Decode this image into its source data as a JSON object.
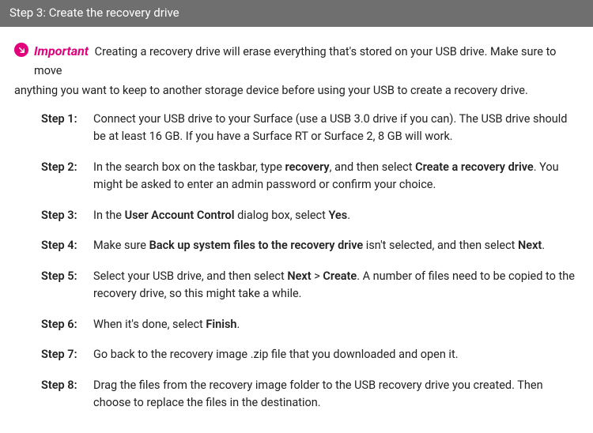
{
  "header": {
    "title": "Step 3: Create the recovery drive"
  },
  "important": {
    "label": "Important",
    "text_a": "Creating a recovery drive will erase everything that's stored on your USB drive. Make sure to move",
    "text_b": "anything you want to keep to another storage device before using your USB to create a recovery drive."
  },
  "steps": [
    {
      "label": "Step 1:",
      "parts": [
        {
          "t": "Connect your USB drive to your Surface (use a USB 3.0 drive if you can). The USB drive should be at least 16 GB. If you have a Surface RT or Surface 2, 8 GB will work."
        }
      ]
    },
    {
      "label": "Step 2:",
      "parts": [
        {
          "t": "In the search box on the taskbar, type "
        },
        {
          "t": "recovery",
          "b": true
        },
        {
          "t": ", and then select "
        },
        {
          "t": "Create a recovery drive",
          "b": true
        },
        {
          "t": ". You might be asked to enter an admin password or confirm your choice."
        }
      ]
    },
    {
      "label": "Step 3:",
      "parts": [
        {
          "t": "In the "
        },
        {
          "t": "User Account Control",
          "b": true
        },
        {
          "t": " dialog box, select "
        },
        {
          "t": "Yes",
          "b": true
        },
        {
          "t": "."
        }
      ]
    },
    {
      "label": "Step 4:",
      "parts": [
        {
          "t": "Make sure "
        },
        {
          "t": "Back up system files to the recovery drive",
          "b": true
        },
        {
          "t": " isn't selected, and then select "
        },
        {
          "t": "Next",
          "b": true
        },
        {
          "t": "."
        }
      ]
    },
    {
      "label": "Step 5:",
      "parts": [
        {
          "t": "Select your USB drive, and then select "
        },
        {
          "t": "Next",
          "b": true
        },
        {
          "t": " > "
        },
        {
          "t": "Create",
          "b": true
        },
        {
          "t": ". A number of files need to be copied to the recovery drive, so this might take a while."
        }
      ]
    },
    {
      "label": "Step 6:",
      "parts": [
        {
          "t": "When it's done, select "
        },
        {
          "t": "Finish",
          "b": true
        },
        {
          "t": "."
        }
      ]
    },
    {
      "label": "Step 7:",
      "parts": [
        {
          "t": "Go back to the recovery image .zip file that you downloaded and open it."
        }
      ]
    },
    {
      "label": "Step 8:",
      "parts": [
        {
          "t": "Drag the files from the recovery image folder to the USB recovery drive you created. Then choose to replace the files in the destination."
        }
      ]
    }
  ]
}
